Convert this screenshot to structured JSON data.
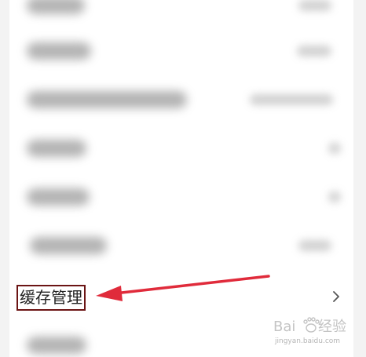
{
  "settings": {
    "cache_item": {
      "label": "缓存管理",
      "chevron_icon": "chevron-right-icon"
    }
  },
  "annotation": {
    "arrow_color": "#e02b3b",
    "highlight_box_color": "#6b1414"
  },
  "watermark": {
    "logo": "Baidu 经验",
    "url": "jingyan.baidu.com"
  },
  "colors": {
    "background": "#f3f3f3",
    "card": "#ffffff",
    "text": "#222222",
    "chevron": "#555555"
  }
}
